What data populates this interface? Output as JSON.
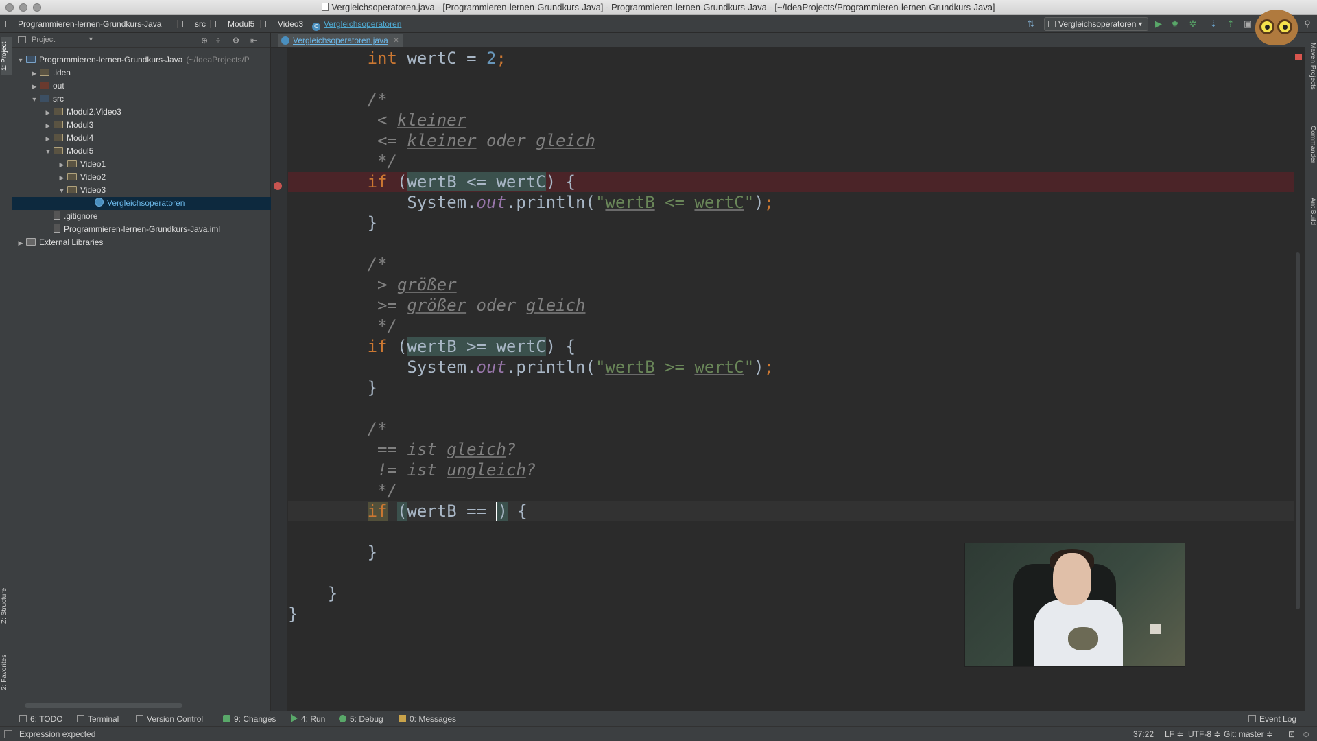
{
  "window": {
    "title": "Vergleichsoperatoren.java - [Programmieren-lernen-Grundkurs-Java] - Programmieren-lernen-Grundkurs-Java - [~/IdeaProjects/Programmieren-lernen-Grundkurs-Java]"
  },
  "navbar": {
    "crumbs": [
      "Programmieren-lernen-Grundkurs-Java",
      "src",
      "Modul5",
      "Video3",
      "Vergleichsoperatoren"
    ],
    "run_config": "Vergleichsoperatoren"
  },
  "left_tools": {
    "project": "1: Project",
    "structure": "Z: Structure",
    "favorites": "2: Favorites"
  },
  "right_tools": {
    "maven": "Maven Projects",
    "commander": "Commander",
    "ant": "Ant Build"
  },
  "project_panel": {
    "header": "Project",
    "tree": [
      {
        "label": "Programmieren-lernen-Grundkurs-Java",
        "sub": "(~/IdeaProjects/P",
        "level": 0,
        "arrow": "down",
        "icon": "blue"
      },
      {
        "label": ".idea",
        "level": 1,
        "arrow": "right",
        "icon": "folder"
      },
      {
        "label": "out",
        "level": 1,
        "arrow": "right",
        "icon": "red"
      },
      {
        "label": "src",
        "level": 1,
        "arrow": "down",
        "icon": "blue"
      },
      {
        "label": "Modul2.Video3",
        "level": 2,
        "arrow": "right",
        "icon": "folder"
      },
      {
        "label": "Modul3",
        "level": 2,
        "arrow": "right",
        "icon": "folder"
      },
      {
        "label": "Modul4",
        "level": 2,
        "arrow": "right",
        "icon": "folder"
      },
      {
        "label": "Modul5",
        "level": 2,
        "arrow": "down",
        "icon": "folder"
      },
      {
        "label": "Video1",
        "level": 3,
        "arrow": "right",
        "icon": "folder"
      },
      {
        "label": "Video2",
        "level": 3,
        "arrow": "right",
        "icon": "folder"
      },
      {
        "label": "Video3",
        "level": 3,
        "arrow": "down",
        "icon": "folder"
      },
      {
        "label": "Vergleichsoperatoren",
        "level": 5,
        "arrow": "",
        "icon": "cls",
        "selected": true
      },
      {
        "label": ".gitignore",
        "level": 2,
        "arrow": "",
        "icon": "file"
      },
      {
        "label": "Programmieren-lernen-Grundkurs-Java.iml",
        "level": 2,
        "arrow": "",
        "icon": "file"
      },
      {
        "label": "External Libraries",
        "level": 0,
        "arrow": "right",
        "icon": "lib"
      }
    ]
  },
  "editor": {
    "tab_label": "Vergleichsoperatoren.java",
    "lines": [
      "        int wertC = 2;",
      "",
      "        /*",
      "         < kleiner",
      "         <= kleiner oder gleich",
      "         */",
      "        if (wertB <= wertC) {",
      "            System.out.println(\"wertB <= wertC\");",
      "        }",
      "",
      "        /*",
      "         > größer",
      "         >= größer oder gleich",
      "         */",
      "        if (wertB >= wertC) {",
      "            System.out.println(\"wertB >= wertC\");",
      "        }",
      "",
      "        /*",
      "         == ist gleich?",
      "         != ist ungleich?",
      "         */",
      "        if (wertB == ) {",
      "",
      "        }",
      "",
      "    }",
      "}"
    ]
  },
  "bottom_tools": {
    "todo": "6: TODO",
    "terminal": "Terminal",
    "vcs": "Version Control",
    "changes": "9: Changes",
    "run": "4: Run",
    "debug": "5: Debug",
    "messages": "0: Messages",
    "event_log": "Event Log"
  },
  "status": {
    "message": "Expression expected",
    "position": "37:22",
    "line_sep": "LF ≑",
    "encoding": "UTF-8 ≑",
    "git": "Git: master ≑"
  }
}
